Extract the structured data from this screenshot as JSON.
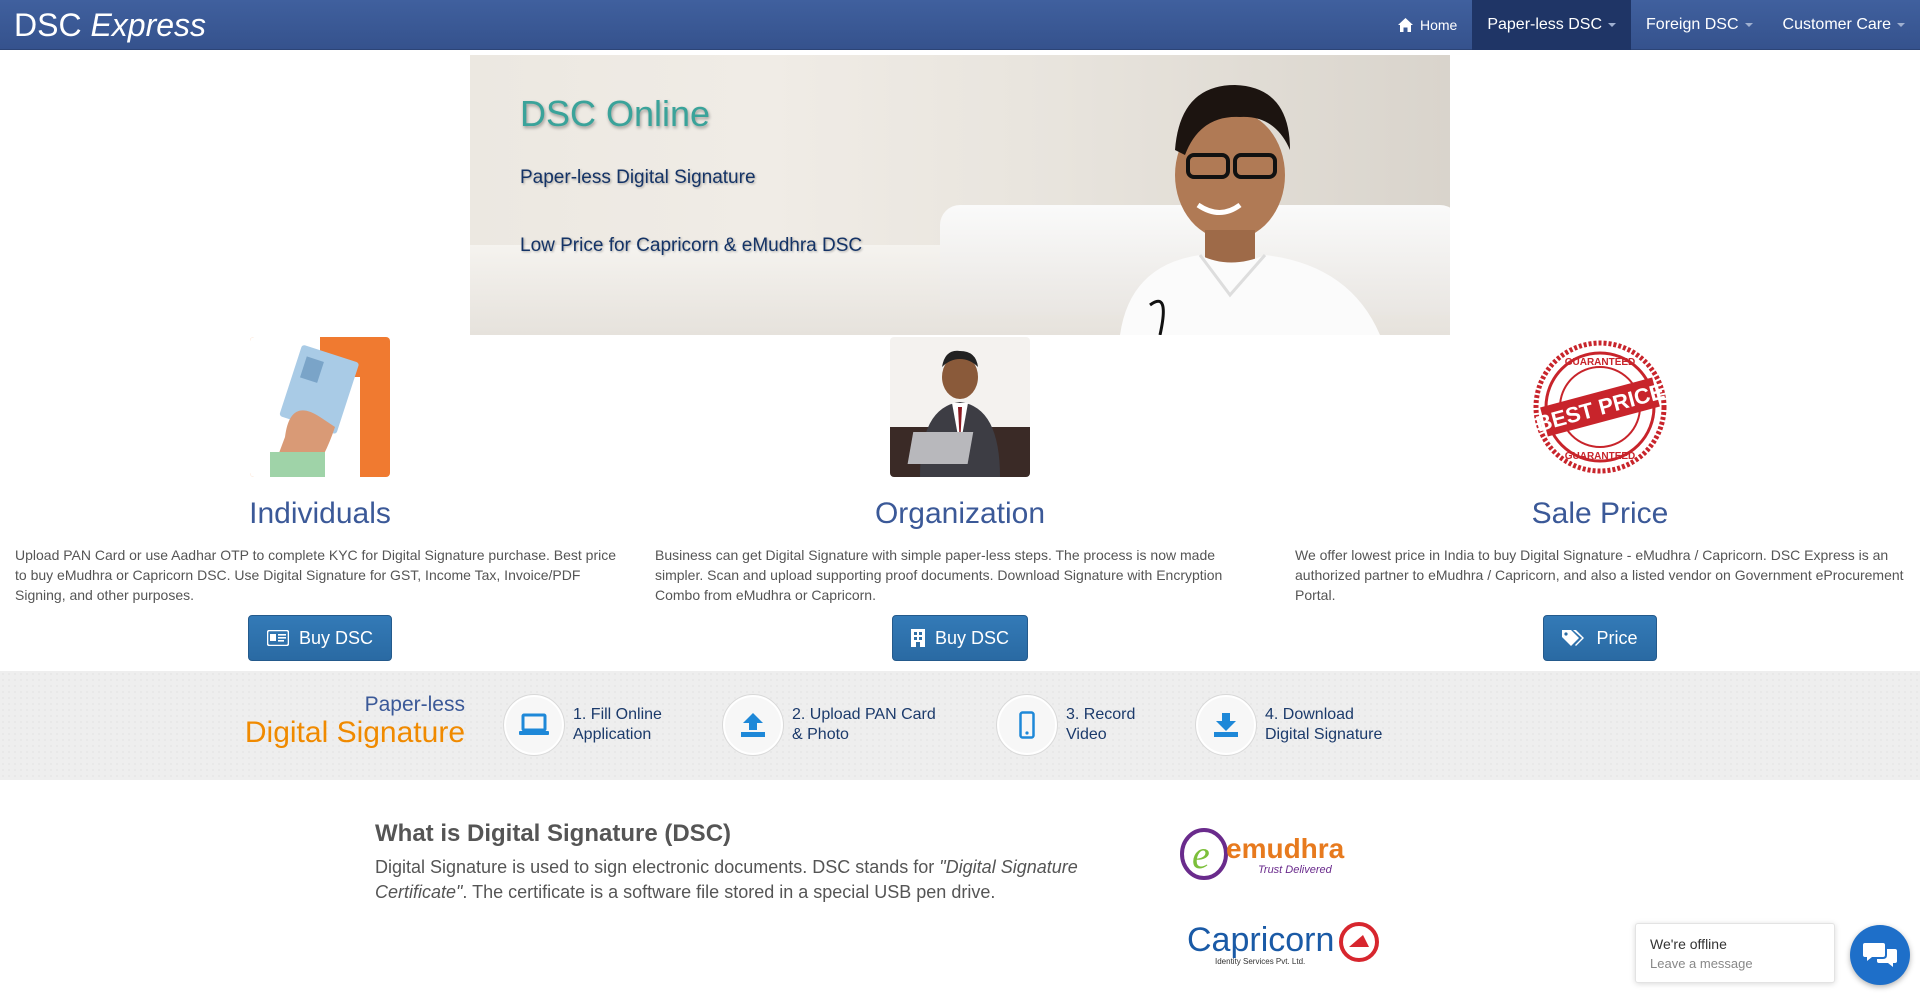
{
  "navbar": {
    "brand_main": "DSC ",
    "brand_italic": "Express",
    "home": "Home",
    "paperless": "Paper-less DSC",
    "foreign": "Foreign DSC",
    "customer_care": "Customer Care"
  },
  "hero": {
    "title": "DSC Online",
    "line1": "Paper-less Digital Signature",
    "line2": "Low Price for Capricorn & eMudhra DSC"
  },
  "features": [
    {
      "title": "Individuals",
      "text": "Upload PAN Card or use Aadhar OTP to complete KYC for Digital Signature purchase. Best price to buy eMudhra or Capricorn DSC. Use Digital Signature for GST, Income Tax, Invoice/PDF Signing, and other purposes.",
      "button": "Buy DSC"
    },
    {
      "title": "Organization",
      "text": "Business can get Digital Signature with simple paper-less steps. The process is now made simpler. Scan and upload supporting proof documents. Download Signature with Encryption Combo from eMudhra or Capricorn.",
      "button": "Buy DSC"
    },
    {
      "title": "Sale Price",
      "text": "We offer lowest price in India to buy Digital Signature - eMudhra / Capricorn. DSC Express is an authorized partner to eMudhra / Capricorn, and also a listed vendor on Government eProcurement Portal.",
      "button": "Price"
    }
  ],
  "best_price_stamp": {
    "top": "GUARANTEED",
    "main": "BEST PRICE",
    "bottom": "GUARANTEED"
  },
  "steps": {
    "title1": "Paper-less",
    "title2": "Digital Signature",
    "items": [
      {
        "line1": "1. Fill Online",
        "line2": "Application",
        "icon": "laptop-icon"
      },
      {
        "line1": "2. Upload PAN Card",
        "line2": "& Photo",
        "icon": "upload-icon"
      },
      {
        "line1": "3. Record",
        "line2": "Video",
        "icon": "mobile-icon"
      },
      {
        "line1": "4. Download",
        "line2": "Digital Signature",
        "icon": "download-icon"
      }
    ]
  },
  "what": {
    "heading": "What is Digital Signature (DSC)",
    "text_a": "Digital Signature is used to sign electronic documents. DSC stands for ",
    "text_italic": "\"Digital Signature Certificate\"",
    "text_b": ". The certificate is a software file stored in a special USB pen drive."
  },
  "logos": {
    "emudhra": "emudhra",
    "emudhra_tag": "Trust Delivered",
    "capricorn": "Capricorn",
    "capricorn_tag": "Identity Services Pvt. Ltd."
  },
  "chat": {
    "status": "We're offline",
    "action": "Leave a message"
  },
  "colors": {
    "navbar": "#3b5998",
    "accent_orange": "#f08a00",
    "button_blue": "#337ab7",
    "hero_title": "#3aa39a"
  }
}
